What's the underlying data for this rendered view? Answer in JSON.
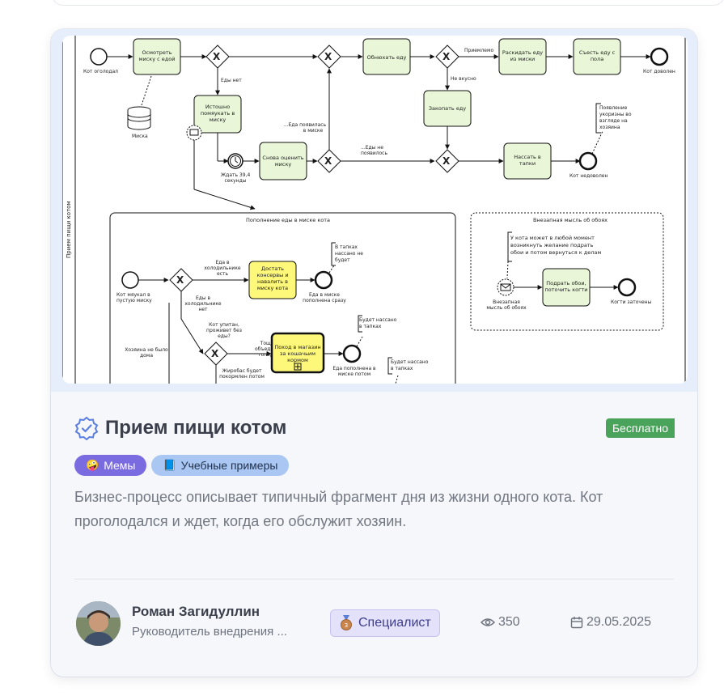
{
  "card": {
    "title": "Прием пищи котом",
    "price_badge": "Бесплатно",
    "tags": [
      {
        "icon": "🤪",
        "label": "Мемы"
      },
      {
        "icon": "📘",
        "label": "Учебные примеры"
      }
    ],
    "description": "Бизнес-процесс описывает типичный фрагмент дня из жизни одного кота. Кот проголодался и ждет, когда его обслужит хозяин.",
    "author": {
      "name": "Роман Загидуллин",
      "role": "Руководитель внедрения ..."
    },
    "level": "Специалист",
    "views": "350",
    "date": "29.05.2025"
  },
  "diagram": {
    "pool_label": "Прием пищи котом",
    "start_event": "Кот оголодал",
    "task_inspect": [
      "Осмотреть",
      "миску с едой"
    ],
    "datastore": "Миска",
    "flow_no_food": "Еды нет",
    "task_meow": [
      "Истошно",
      "помяукать в",
      "миску"
    ],
    "timer": [
      "Ждать 39,4",
      "секунды"
    ],
    "task_recheck": [
      "Снова оценить",
      "миску"
    ],
    "flow_food_appeared": [
      "...Еда появилась",
      "в миске"
    ],
    "flow_food_not": [
      "...Еды не",
      "появилось"
    ],
    "task_sniff": "Обнюхать еду",
    "flow_ok": "Приемлемо",
    "flow_bad": "Не вкусно",
    "task_scatter": [
      "Раскидать еду",
      "из миски"
    ],
    "task_eat": [
      "Съесть еду с",
      "пола"
    ],
    "end_satisfied": "Кот доволен",
    "task_bury": "Закопать еду",
    "task_slippers": [
      "Нассать в",
      "тапки"
    ],
    "end_unhappy": "Кот недоволен",
    "annotation_hate": [
      "Появление",
      "укоризны во",
      "взгляде на",
      "хозяина"
    ],
    "sub_title": "Пополнение еды в миске кота",
    "sub_start": [
      "Кот мяукал в",
      "пустую миску"
    ],
    "sub_flow_fridge_yes": [
      "Еда в",
      "холодильнике",
      "есть"
    ],
    "sub_flow_fridge_no": [
      "Еды в",
      "холодильнике",
      "нет"
    ],
    "sub_task_get": [
      "Достать",
      "консервы и",
      "навалить в",
      "миску кота"
    ],
    "sub_end_fast": [
      "Еда в миске",
      "пополнена сразу"
    ],
    "sub_annot_slippers1": [
      "В тапках",
      "нассано не",
      "будет"
    ],
    "sub_flow_survive": [
      "Кот упитан,",
      "проживет без",
      "еды?"
    ],
    "sub_flow_thin": [
      "Тощий и",
      "объедаемый",
      "голодный"
    ],
    "sub_task_shop": [
      "Поход в магазин",
      "за кошачьим",
      "кормом"
    ],
    "sub_end_later": [
      "Еда пополнена в",
      "миске потом"
    ],
    "sub_annot_slippers2": [
      "Будет нассано",
      "в тапках"
    ],
    "sub_annot_slippers3": [
      "Будет нассано",
      "в тапках"
    ],
    "sub_flow_owner_away": [
      "Хозяина не было",
      "дома"
    ],
    "sub_flow_fat": [
      "Жиробас будет",
      "покормлен потом"
    ],
    "event_title": "Внезапная мысль об обоях",
    "event_annot": [
      "У кота может в любой момент",
      "возникнуть желание подрать",
      "обои и потом вернуться к делам"
    ],
    "event_start": [
      "Внезапная",
      "мысль об обоях"
    ],
    "event_task": [
      "Подрать обои,",
      "поточить когти"
    ],
    "event_end": "Когти заточены"
  }
}
